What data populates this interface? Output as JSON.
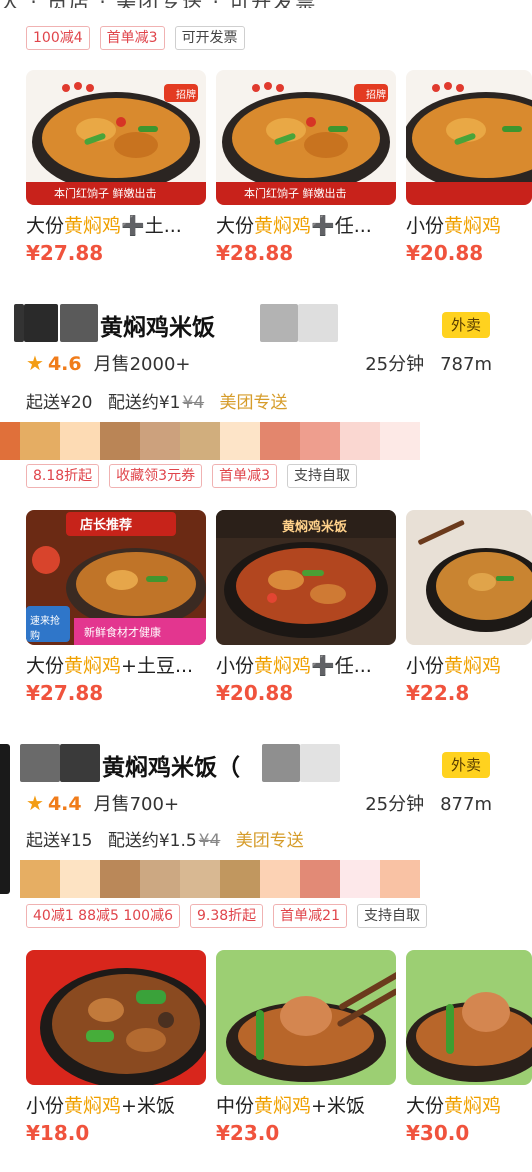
{
  "top_cut_text": "大 ‧ 员店 ‧ 美团专送 ‧ 可开发票",
  "shop1": {
    "tags": [
      {
        "label": "100减4",
        "style": "red"
      },
      {
        "label": "首单减3",
        "style": "red"
      },
      {
        "label": "可开发票",
        "style": "gray"
      }
    ],
    "dishes": [
      {
        "prefix": "大份",
        "kw": "黄焖鸡",
        "suffix": "➕土...",
        "price": "¥27.88"
      },
      {
        "prefix": "大份",
        "kw": "黄焖鸡",
        "suffix": "➕任...",
        "price": "¥28.88"
      },
      {
        "prefix": "小份",
        "kw": "黄焖鸡",
        "suffix": "",
        "price": "¥20.88"
      }
    ],
    "img_banner": "本门红饷子 鲜嫩出击",
    "img_sticker": "招牌"
  },
  "shop2": {
    "name": "黄焖鸡米饭",
    "badge": "外卖",
    "rating": "4.6",
    "sold": "月售2000+",
    "time": "25分钟",
    "distance": "787m",
    "min_order": "起送¥20",
    "delivery_fee": "配送约¥1",
    "orig_fee": "¥4",
    "delivery_type": "美团专送",
    "tags": [
      {
        "label": "8.18折起",
        "style": "red"
      },
      {
        "label": "收藏领3元券",
        "style": "red"
      },
      {
        "label": "首单减3",
        "style": "red"
      },
      {
        "label": "支持自取",
        "style": "gray"
      }
    ],
    "palette": [
      "#e5ad63",
      "#fddbb4",
      "#ba8556",
      "#cca17d",
      "#d1ae7d",
      "#fde4c8",
      "#e3866d",
      "#ee9e8e",
      "#fad7d1",
      "#fde9e6"
    ],
    "dishes": [
      {
        "prefix": "大份",
        "kw": "黄焖鸡",
        "suffix": "+土豆...",
        "price": "¥27.88"
      },
      {
        "prefix": "小份",
        "kw": "黄焖鸡",
        "suffix": "➕任...",
        "price": "¥20.88"
      },
      {
        "prefix": "小份",
        "kw": "黄焖鸡",
        "suffix": "",
        "price": "¥22.8"
      }
    ],
    "img1_banner": "店长推荐",
    "img1_tag_a": "速来抢购",
    "img1_tag_b": "新鲜食材才健康",
    "img2_banner": "黄焖鸡米饭"
  },
  "shop3": {
    "name": "黄焖鸡米饭（",
    "badge": "外卖",
    "rating": "4.4",
    "sold": "月售700+",
    "time": "25分钟",
    "distance": "877m",
    "min_order": "起送¥15",
    "delivery_fee": "配送约¥1.5",
    "orig_fee": "¥4",
    "delivery_type": "美团专送",
    "tags": [
      {
        "label": "40减1 88减5 100减6",
        "style": "red"
      },
      {
        "label": "9.38折起",
        "style": "red"
      },
      {
        "label": "首单减21",
        "style": "red"
      },
      {
        "label": "支持自取",
        "style": "gray"
      }
    ],
    "palette": [
      "#e6ae63",
      "#fde3c3",
      "#ba8859",
      "#cca882",
      "#d8b892",
      "#c1975f",
      "#fcd2b4",
      "#e28a76",
      "#fde8ea",
      "#f9c2a4"
    ],
    "dishes": [
      {
        "prefix": "小份",
        "kw": "黄焖鸡",
        "suffix": "+米饭",
        "price": "¥18.0"
      },
      {
        "prefix": "中份",
        "kw": "黄焖鸡",
        "suffix": "+米饭",
        "price": "¥23.0"
      },
      {
        "prefix": "大份",
        "kw": "黄焖鸡",
        "suffix": "",
        "price": "¥30.0"
      }
    ]
  },
  "icons": {
    "star": "★"
  },
  "colors": {
    "accent_orange": "#f0a000",
    "price_red": "#f0533d",
    "badge_yellow": "#ffd21f"
  }
}
